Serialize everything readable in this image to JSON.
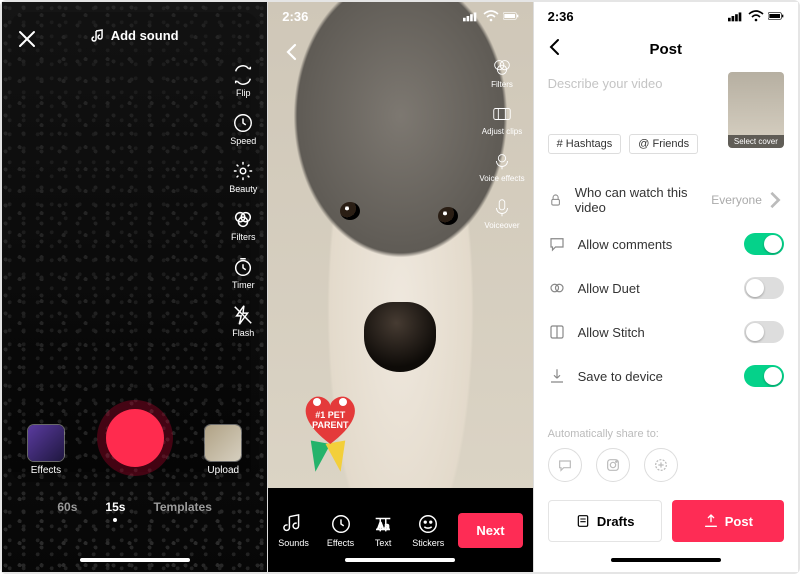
{
  "status": {
    "time": "2:36"
  },
  "camera": {
    "add_sound": "Add sound",
    "tools": {
      "flip": "Flip",
      "speed": "Speed",
      "beauty": "Beauty",
      "filters": "Filters",
      "timer": "Timer",
      "flash": "Flash"
    },
    "effects": "Effects",
    "upload": "Upload",
    "tabs": {
      "t60": "60s",
      "t15": "15s",
      "templates": "Templates"
    }
  },
  "preview": {
    "tools": {
      "filters": "Filters",
      "adjust": "Adjust clips",
      "voice": "Voice effects",
      "vo": "Voiceover"
    },
    "sticker_text": "#1 PET PARENT",
    "bottom": {
      "sounds": "Sounds",
      "effects": "Effects",
      "text": "Text",
      "stickers": "Stickers"
    },
    "next": "Next"
  },
  "post": {
    "title": "Post",
    "placeholder": "Describe your video",
    "cover": "Select cover",
    "chips": {
      "hashtags": "# Hashtags",
      "friends": "@ Friends"
    },
    "rows": {
      "privacy": {
        "label": "Who can watch this video",
        "value": "Everyone"
      },
      "comments": "Allow comments",
      "duet": "Allow Duet",
      "stitch": "Allow Stitch",
      "save": "Save to device"
    },
    "share_label": "Automatically share to:",
    "drafts": "Drafts",
    "post_btn": "Post"
  }
}
